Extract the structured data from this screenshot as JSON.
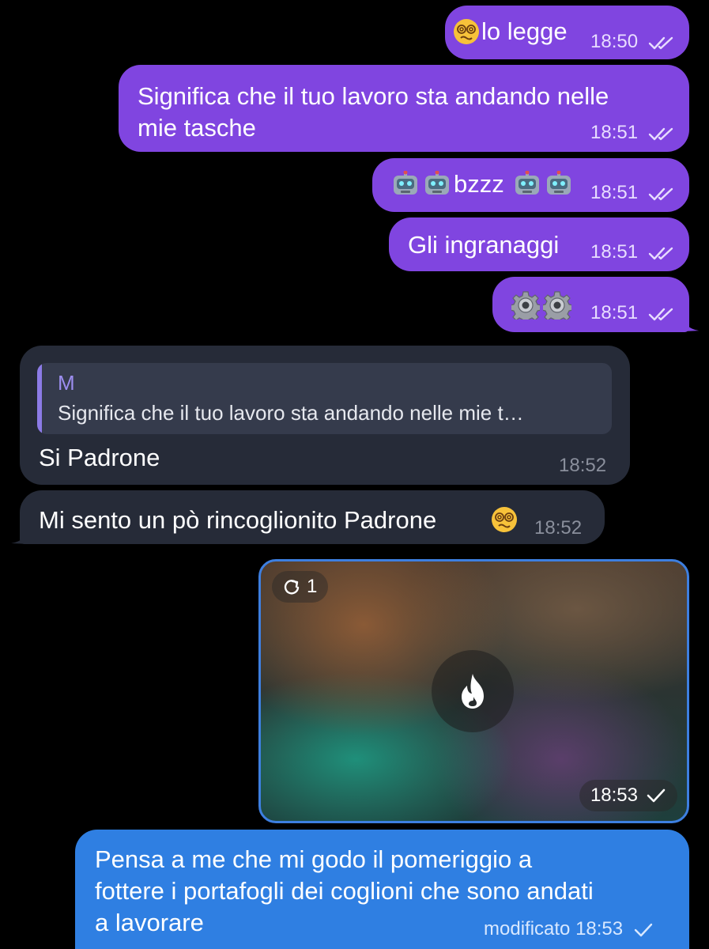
{
  "chat": {
    "messages": [
      {
        "id": "m1",
        "direction": "outgoing",
        "emoji_name": "face-with-spiral-eyes",
        "text": "lo legge",
        "time": "18:50",
        "status": "read"
      },
      {
        "id": "m2",
        "direction": "outgoing",
        "text_line1": "Significa che il tuo lavoro sta andando nelle",
        "text_line2": "mie tasche",
        "time": "18:51",
        "status": "read"
      },
      {
        "id": "m3",
        "direction": "outgoing",
        "emoji_name": "robot-face",
        "text": "bzzz",
        "time": "18:51",
        "status": "read"
      },
      {
        "id": "m4",
        "direction": "outgoing",
        "text": "Gli ingranaggi",
        "time": "18:51",
        "status": "read"
      },
      {
        "id": "m5",
        "direction": "outgoing",
        "emoji_name": "gear",
        "time": "18:51",
        "status": "read"
      },
      {
        "id": "m6",
        "direction": "incoming",
        "reply": {
          "author": "M",
          "text": "Significa che il tuo lavoro sta andando nelle mie t…"
        },
        "text": "Si Padrone",
        "time": "18:52"
      },
      {
        "id": "m7",
        "direction": "incoming",
        "text": "Mi sento un pò rincoglionito Padrone",
        "emoji_name": "face-with-spiral-eyes",
        "time": "18:52"
      },
      {
        "id": "m8",
        "direction": "outgoing",
        "type": "view-once-media",
        "view_count": "1",
        "time": "18:53",
        "status": "sent"
      },
      {
        "id": "m9",
        "direction": "outgoing",
        "text_line1": "Pensa a me che mi godo il pomeriggio a",
        "text_line2": "fottere i portafogli dei coglioni che sono andati",
        "text_line3": "a lavorare",
        "edited_label": "modificato",
        "time": "18:53",
        "status": "sent"
      }
    ]
  },
  "colors": {
    "background": "#000000",
    "outgoing_bubble": "#8045e0",
    "incoming_bubble": "#262b38",
    "edited_bubble": "#2f7fe2",
    "quote_accent": "#8c7be6"
  }
}
